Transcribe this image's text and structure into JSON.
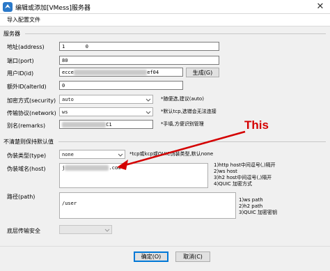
{
  "window": {
    "title": "编辑或添加[VMess]服务器",
    "close_glyph": "✕"
  },
  "menu": {
    "import_config": "导入配置文件"
  },
  "server_section": {
    "title": "服务器",
    "address": {
      "label": "地址(address)",
      "value": "1       0"
    },
    "port": {
      "label": "端口(port)",
      "value": "80"
    },
    "user_id": {
      "label": "用户ID(id)",
      "value_start": "ecce",
      "value_end": "ef04",
      "generate_button": "生成(G)"
    },
    "alter_id": {
      "label": "额外ID(alterId)",
      "value": "0"
    },
    "security": {
      "label": "加密方式(security)",
      "value": "auto",
      "hint": "*随便选,建议(auto)"
    },
    "network": {
      "label": "传输协议(network)",
      "value": "ws",
      "hint": "*默认tcp,选错会无法连接"
    },
    "remarks": {
      "label": "别名(remarks)",
      "value_end": "C1",
      "hint": "*手填,方便识别管理"
    }
  },
  "advanced_section": {
    "title": "不清楚则保持默认值",
    "header_type": {
      "label": "伪装类型(type)",
      "value": "none",
      "hint": "*tcp或kcp或QUIC伪装类型,默认none"
    },
    "host": {
      "label": "伪装域名(host)",
      "value_start": "j",
      "value_end": ".com",
      "hint": "1)http host中间逗号(,)隔开\n2)ws host\n3)h2 host中间逗号(,)隔开\n4)QUIC 加密方式"
    },
    "path": {
      "label": "路径(path)",
      "value": "/user",
      "hint": "1)ws path\n2)h2 path\n3)QUIC 加密密钥"
    },
    "stream_security": {
      "label": "底层传输安全",
      "value": ""
    }
  },
  "footer": {
    "ok_button": "确定(O)",
    "cancel_button": "取消(C)"
  },
  "annotation": {
    "text": "This",
    "color": "#d40000"
  },
  "colors": {
    "accent": "#0078d7",
    "annotation_red": "#d40000"
  }
}
